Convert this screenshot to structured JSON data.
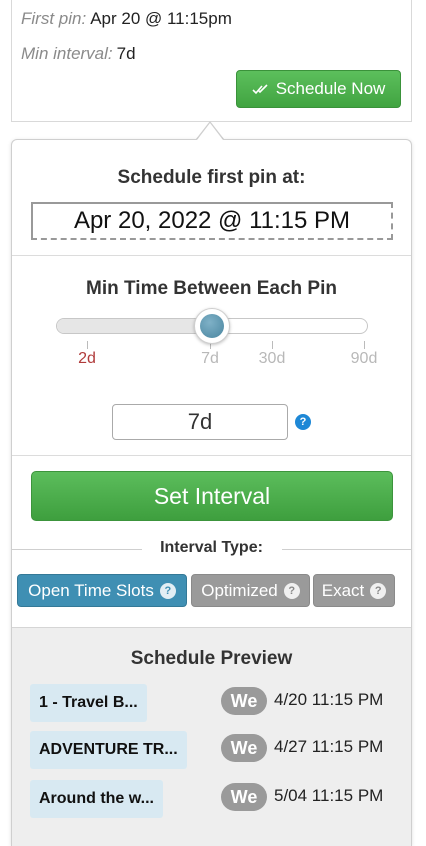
{
  "summary": {
    "first_pin_label": "First pin:",
    "first_pin_value": "Apr 20 @ 11:15pm",
    "min_interval_label": "Min interval:",
    "min_interval_value": "7d",
    "schedule_now_label": "Schedule Now"
  },
  "popover": {
    "first_pin_heading": "Schedule first pin at:",
    "first_pin_datetime": "Apr 20, 2022 @ 11:15 PM",
    "interval_heading": "Min Time Between Each Pin",
    "slider": {
      "value_fraction": 0.5,
      "ticks": [
        {
          "label": "2d",
          "active": true
        },
        {
          "label": "7d",
          "active": false
        },
        {
          "label": "30d",
          "active": false
        },
        {
          "label": "90d",
          "active": false
        }
      ]
    },
    "interval_value": "7d",
    "help_glyph": "?",
    "set_interval_label": "Set Interval",
    "interval_type_heading": "Interval Type:",
    "interval_types": [
      {
        "label": "Open Time Slots",
        "selected": true
      },
      {
        "label": "Optimized",
        "selected": false
      },
      {
        "label": "Exact",
        "selected": false
      }
    ]
  },
  "preview": {
    "heading": "Schedule Preview",
    "items": [
      {
        "title": "1 - Travel B...",
        "day": "We",
        "time": "4/20 11:15 PM"
      },
      {
        "title": "ADVENTURE TR...",
        "day": "We",
        "time": "4/27 11:15 PM"
      },
      {
        "title": "Around the w...",
        "day": "We",
        "time": "5/04 11:15 PM"
      }
    ]
  },
  "colors": {
    "green": "#41a441",
    "selected_blue": "#3f8fb3",
    "help_blue": "#1e88d6",
    "active_tick": "#b03a3a"
  }
}
